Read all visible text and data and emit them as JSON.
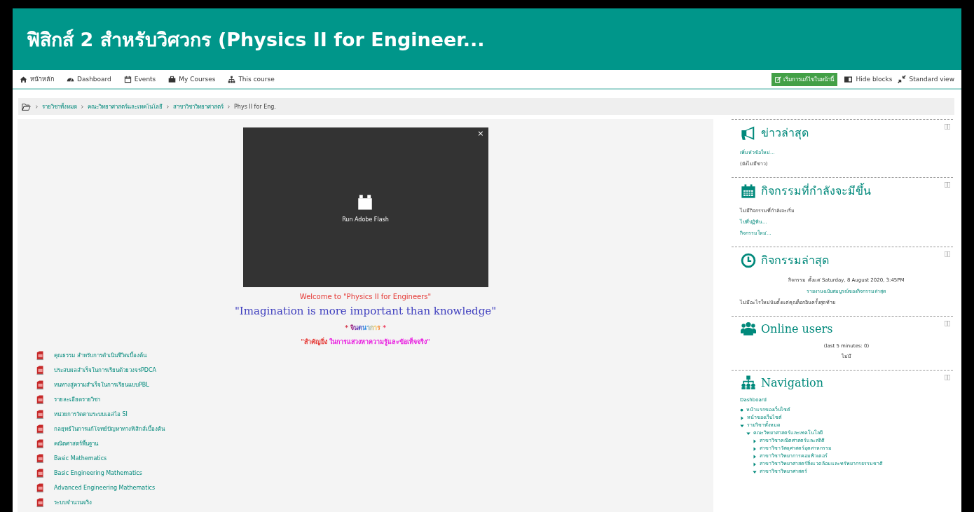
{
  "header": {
    "title": "ฟิสิกส์ 2 สำหรับวิศวกร (Physics II for Engineer..."
  },
  "navbar": {
    "items": [
      {
        "kind": "home",
        "label": "หน้าหลัก"
      },
      {
        "kind": "dashboard",
        "label": "Dashboard"
      },
      {
        "kind": "calendar",
        "label": "Events"
      },
      {
        "kind": "briefcase",
        "label": "My Courses"
      },
      {
        "kind": "sitemap",
        "label": "This course"
      }
    ],
    "edit_button": "เริ่มการแก้ไขในหน้านี้",
    "hide_blocks": "Hide blocks",
    "standard_view": "Standard view"
  },
  "breadcrumb": [
    "รายวิชาทั้งหมด",
    "คณะวิทยาศาสตร์และเทคโนโลยี",
    "สาขาวิชาวิทยาศาสตร์",
    "Phys II for Eng."
  ],
  "flash": {
    "close": "×",
    "label": "Run Adobe Flash"
  },
  "welcome": "Welcome to \"Physics II for Engineers\"",
  "quote": "\"Imagination is more important than knowledge\"",
  "imagination": "* จินตนาการ *",
  "importance": [
    {
      "text": "\"สำคัญยิ่ง ",
      "color": "#e53935"
    },
    {
      "text": "ในการแสวงหาความรู้และข้อเท็จจริง\"",
      "color": "#e91ee0"
    }
  ],
  "resources": [
    "คุณธรรม สำหรับการดำเนินชีวิตเบื้องต้น",
    "ประสบผลสำเร็จในการเรียนด้วยวงจรPDCA",
    "หนทางสู่ความสำเร็จในการเรียนแบบPBL",
    "รายละเอียดรายวิชา",
    "หน่วยการวัดตามระบบเอสไอ SI",
    "กลยุทธ์ในการแก้โจทย์ปัญหาทางฟิสิกส์เบื้องต้น",
    "คณิตศาสตร์พื้นฐาน",
    "Basic Mathematics",
    "Basic Engineering Mathematics",
    "Advanced Engineering Mathematics",
    "ระบบจำนวนจริง"
  ],
  "blocks": [
    {
      "kind": "news",
      "title": "ข่าวล่าสุด",
      "lines": [
        {
          "text": "เพิ่มหัวข้อใหม่...",
          "link": true
        },
        {
          "text": "(ยังไม่มีข่าว)",
          "link": false
        }
      ]
    },
    {
      "kind": "calendar",
      "title": "กิจกรรมที่กำลังจะมีขึ้น",
      "lines": [
        {
          "text": "ไม่มีกิจกรรมที่กำลังจะเริ่ม",
          "link": false
        },
        {
          "text": "ไปที่ปฏิทิน...",
          "link": true
        },
        {
          "text": "กิจกรรมใหม่...",
          "link": true
        }
      ]
    },
    {
      "kind": "recent",
      "title": "กิจกรรมล่าสุด",
      "lines": [
        {
          "text": "กิจกรรม ตั้งแต่ Saturday, 8 August 2020, 3:45PM",
          "link": false,
          "center": true
        },
        {
          "text": "รายงานฉบับสมบูรณ์ของกิจกรรมล่าสุด",
          "link": true,
          "center": true
        },
        {
          "text": "ไม่มีอะไรใหม่นับตั้งแต่คุณล็อกอินครั้งสุดท้าย",
          "link": false
        }
      ]
    },
    {
      "kind": "users",
      "title": "Online users",
      "lines": [
        {
          "text": "(last 5 minutes: 0)",
          "link": false,
          "center": true
        },
        {
          "text": "ไม่มี",
          "link": false,
          "center": true
        }
      ]
    },
    {
      "kind": "navigation",
      "title": "Navigation",
      "root": "Dashboard",
      "tree": [
        {
          "label": "หน้าแรกของเว็บไซต์",
          "kind": "page"
        },
        {
          "label": "หน้าของเว็บไซต์",
          "kind": "branch",
          "expanded": false
        },
        {
          "label": "รายวิชาทั้งหมด",
          "kind": "branch",
          "expanded": true,
          "children": [
            {
              "label": "คณะวิทยาศาสตร์และเทคโนโลยี",
              "kind": "branch",
              "expanded": true,
              "children": [
                {
                  "label": "สาขาวิชาคณิตศาสตร์และสถิติ",
                  "kind": "branch",
                  "expanded": false
                },
                {
                  "label": "สาขาวิชาวัสดุศาสตร์อุตสาหกรรม",
                  "kind": "branch",
                  "expanded": false
                },
                {
                  "label": "สาขาวิชาวิทยาการคอมพิวเตอร์",
                  "kind": "branch",
                  "expanded": false
                },
                {
                  "label": "สาขาวิชาวิทยาศาสตร์สิ่งแวดล้อมและทรัพยากรธรรมชาติ",
                  "kind": "branch",
                  "expanded": false
                },
                {
                  "label": "สาขาวิชาวิทยาศาสตร์",
                  "kind": "branch",
                  "expanded": true
                }
              ]
            }
          ]
        }
      ]
    }
  ]
}
